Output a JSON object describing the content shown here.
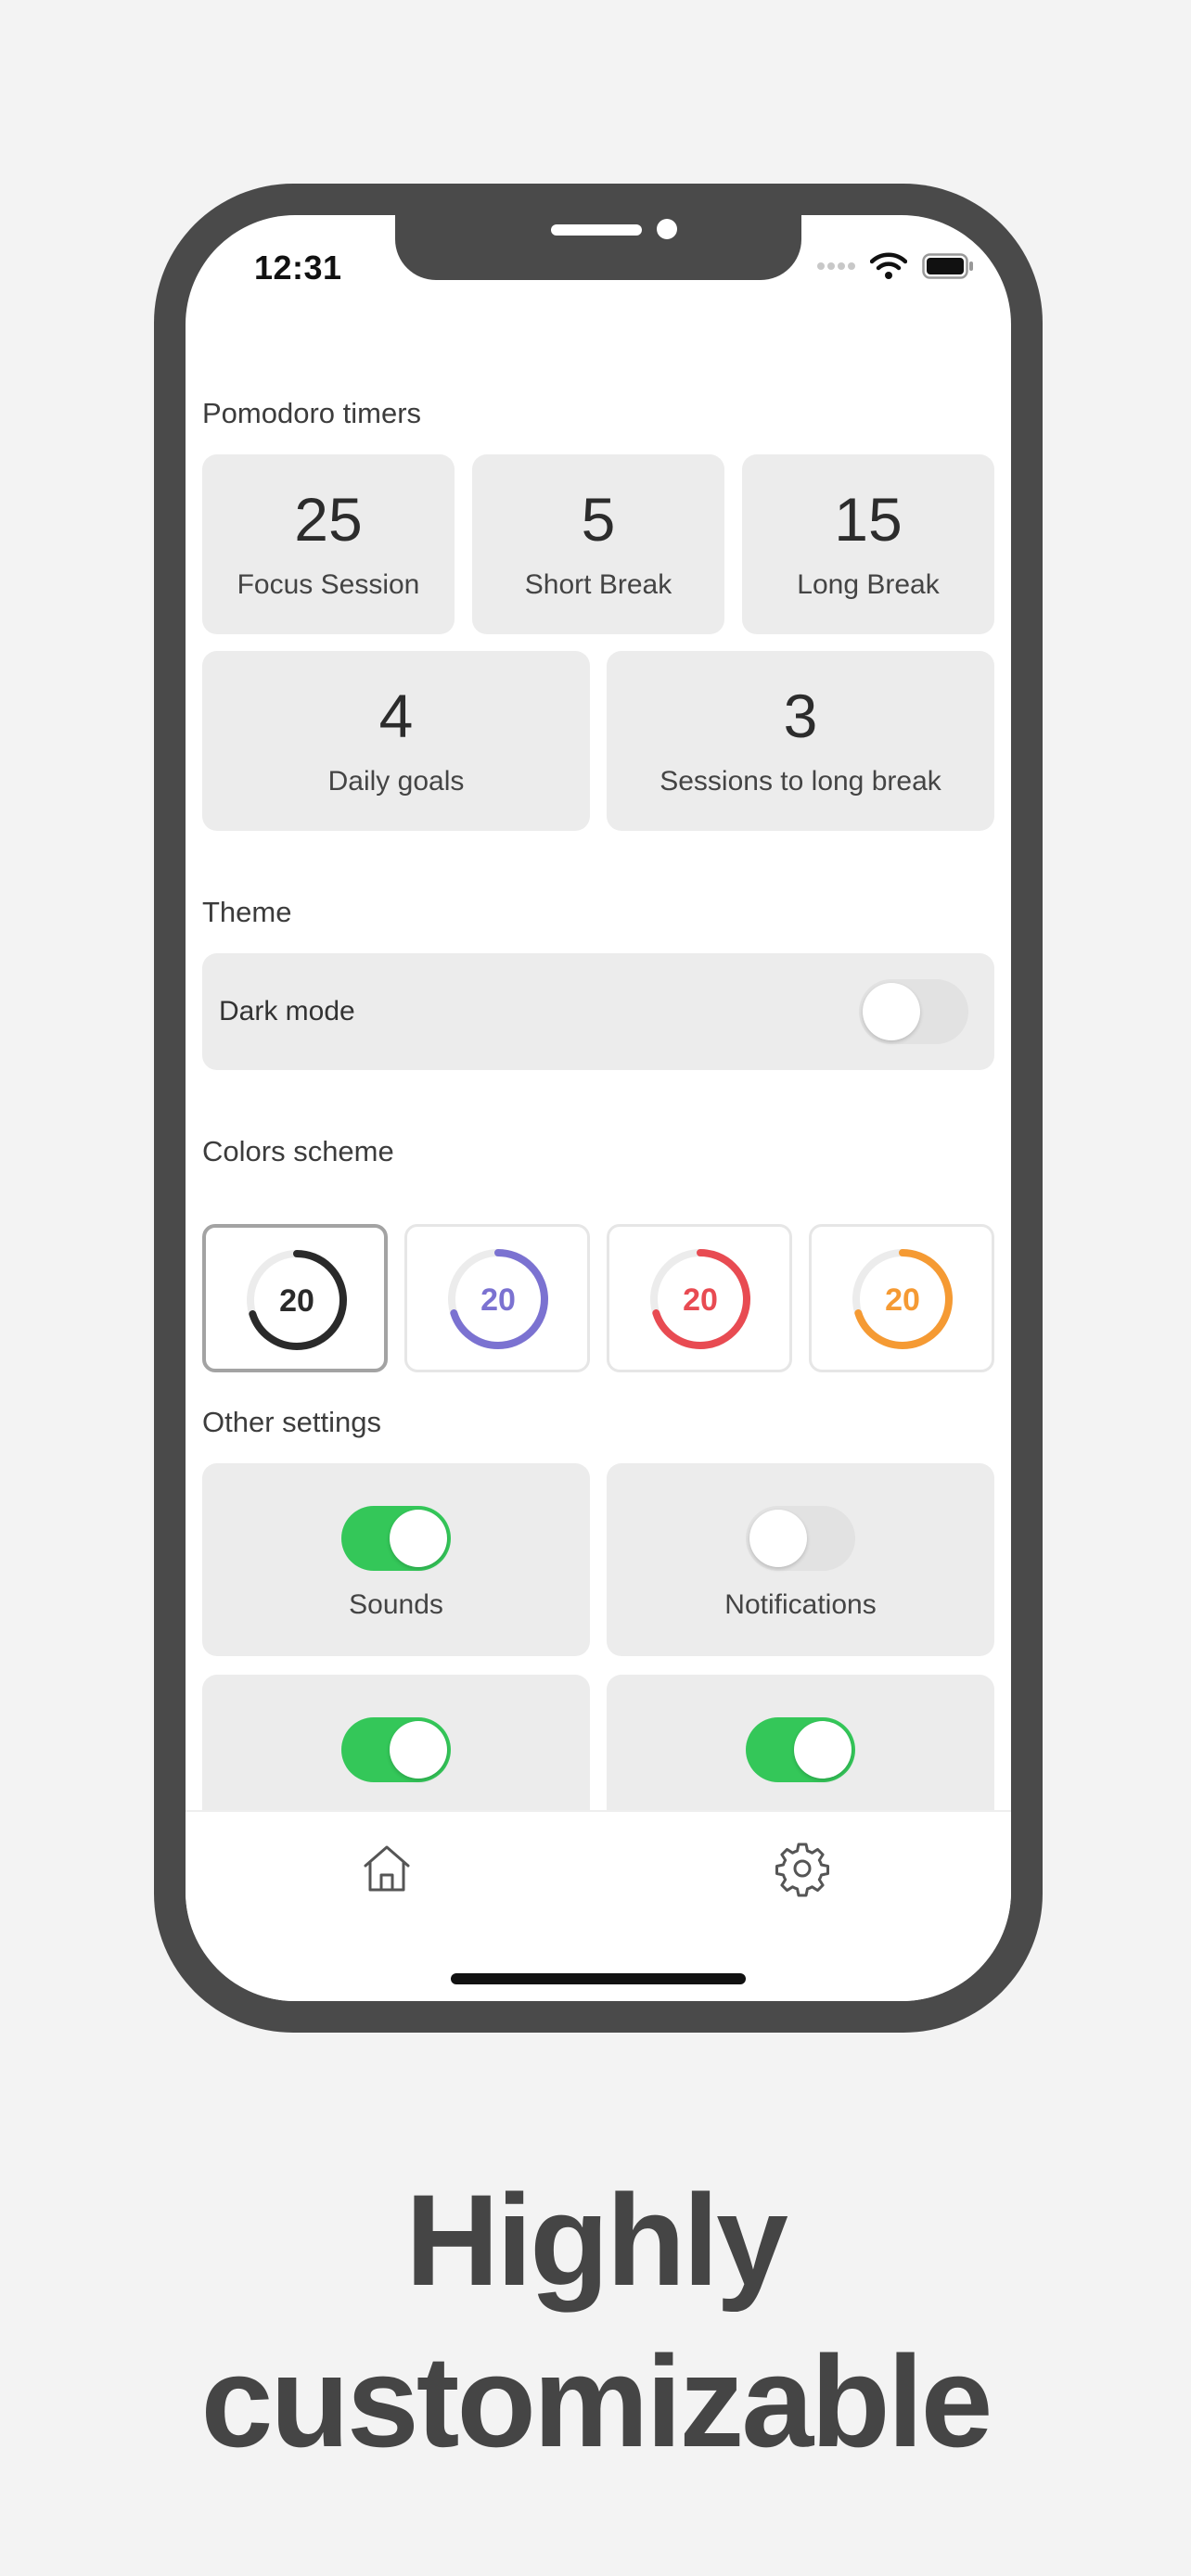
{
  "status_bar": {
    "time": "12:31"
  },
  "sections": {
    "timers_title": "Pomodoro timers",
    "theme_title": "Theme",
    "colors_title": "Colors scheme",
    "other_title": "Other settings"
  },
  "timers": [
    {
      "value": "25",
      "label": "Focus Session"
    },
    {
      "value": "5",
      "label": "Short Break"
    },
    {
      "value": "15",
      "label": "Long Break"
    },
    {
      "value": "4",
      "label": "Daily goals"
    },
    {
      "value": "3",
      "label": "Sessions to long break"
    }
  ],
  "theme": {
    "dark_mode_label": "Dark mode",
    "dark_mode_on": false
  },
  "color_schemes": [
    {
      "value": "20",
      "color": "#2a2a2a",
      "selected": true,
      "progress": 0.7
    },
    {
      "value": "20",
      "color": "#7b72d1",
      "selected": false,
      "progress": 0.7
    },
    {
      "value": "20",
      "color": "#e84b52",
      "selected": false,
      "progress": 0.7
    },
    {
      "value": "20",
      "color": "#f59a33",
      "selected": false,
      "progress": 0.7
    }
  ],
  "other_settings": [
    {
      "label": "Sounds",
      "on": true
    },
    {
      "label": "Notifications",
      "on": false
    },
    {
      "label": "",
      "on": true
    },
    {
      "label": "",
      "on": true
    }
  ],
  "tabbar": {
    "home_icon": "home-icon",
    "settings_icon": "gear-icon"
  },
  "headline": {
    "line1": "Highly",
    "line2": "customizable"
  },
  "colors": {
    "toggle_on": "#34c759",
    "frame": "#4a4a4a",
    "card": "#ececec"
  }
}
